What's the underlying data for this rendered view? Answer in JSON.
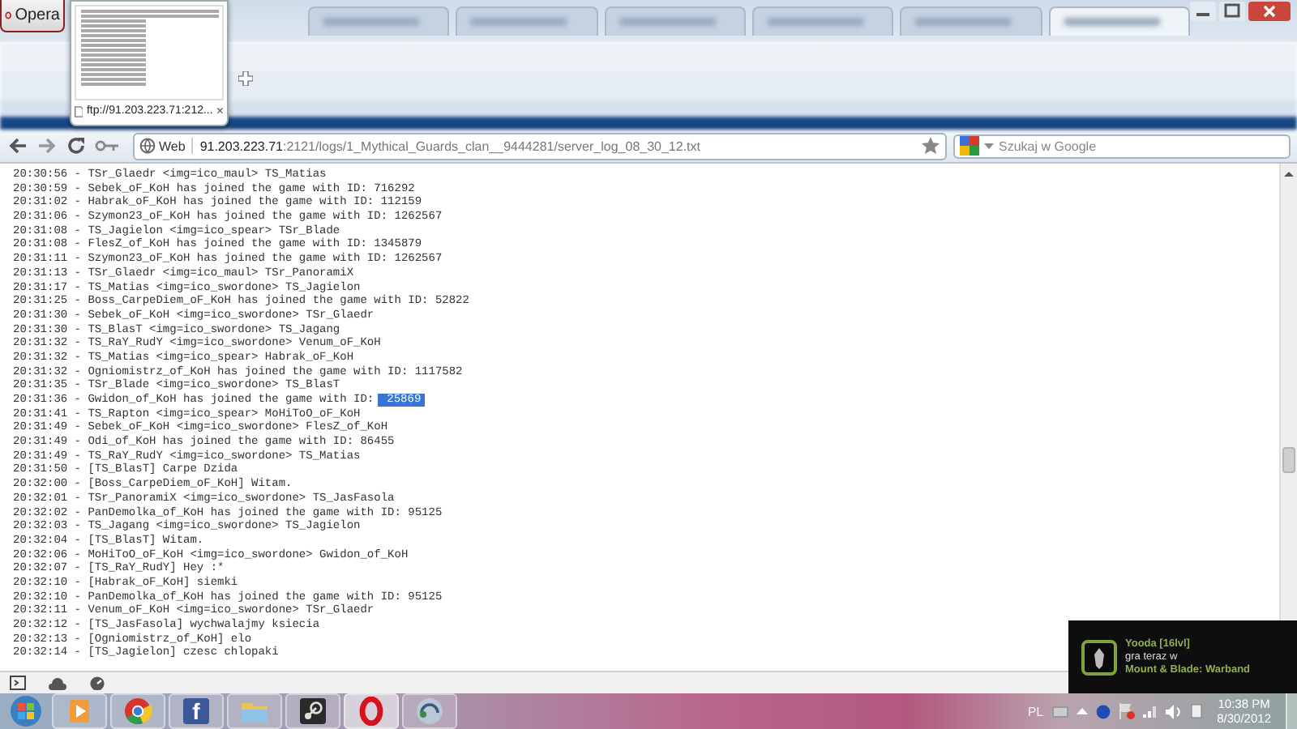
{
  "browser": {
    "menu_button": "Opera",
    "tabs": [
      {
        "selected": false
      },
      {
        "selected": false
      },
      {
        "selected": false
      },
      {
        "selected": false
      },
      {
        "selected": false
      },
      {
        "selected": true
      }
    ]
  },
  "tab_preview": {
    "caption": "ftp://91.203.223.71:212...",
    "close": "×"
  },
  "address_bar": {
    "badge": "Web",
    "url_host": "91.203.223.71",
    "url_rest": ":2121/logs/1_Mythical_Guards_clan__9444281/server_log_08_30_12.txt"
  },
  "search": {
    "placeholder": "Szukaj w Google"
  },
  "log": {
    "lines": [
      {
        "text": "20:30:56 - TSr_Glaedr <img=ico_maul> TS_Matias"
      },
      {
        "text": "20:30:59 - Sebek_oF_KoH has joined the game with ID: 716292"
      },
      {
        "text": "20:31:02 - Habrak_oF_KoH has joined the game with ID: 112159"
      },
      {
        "text": "20:31:06 - Szymon23_oF_KoH has joined the game with ID: 1262567"
      },
      {
        "text": "20:31:08 - TS_Jagielon <img=ico_spear> TSr_Blade"
      },
      {
        "text": "20:31:08 - FlesZ_of_KoH has joined the game with ID: 1345879"
      },
      {
        "text": "20:31:11 - Szymon23_oF_KoH has joined the game with ID: 1262567"
      },
      {
        "text": "20:31:13 - TSr_Glaedr <img=ico_maul> TSr_PanoramiX"
      },
      {
        "text": "20:31:17 - TS_Matias <img=ico_swordone> TS_Jagielon"
      },
      {
        "text": "20:31:25 - Boss_CarpeDiem_oF_KoH has joined the game with ID: 52822"
      },
      {
        "text": "20:31:30 - Sebek_oF_KoH <img=ico_swordone> TSr_Glaedr"
      },
      {
        "text": "20:31:30 - TS_BlasT <img=ico_swordone> TS_Jagang"
      },
      {
        "text": "20:31:32 - TS_RaY_RudY <img=ico_swordone> Venum_oF_KoH"
      },
      {
        "text": "20:31:32 - TS_Matias <img=ico_spear> Habrak_oF_KoH"
      },
      {
        "text": "20:31:32 - Ogniomistrz_of_KoH has joined the game with ID: 1117582"
      },
      {
        "text": "20:31:35 - TSr_Blade <img=ico_swordone> TS_BlasT"
      },
      {
        "text": "20:31:36 - Gwidon_of_KoH has joined the game with ID:",
        "selection": "25869"
      },
      {
        "text": "20:31:41 - TS_Rapton <img=ico_spear> MoHiToO_oF_KoH"
      },
      {
        "text": "20:31:49 - Sebek_oF_KoH <img=ico_swordone> FlesZ_of_KoH"
      },
      {
        "text": "20:31:49 - Odi_of_KoH has joined the game with ID: 86455"
      },
      {
        "text": "20:31:49 - TS_RaY_RudY <img=ico_swordone> TS_Matias"
      },
      {
        "text": "20:31:50 - [TS_BlasT] Carpe Dzida"
      },
      {
        "text": "20:32:00 - [Boss_CarpeDiem_oF_KoH] Witam."
      },
      {
        "text": "20:32:01 - TSr_PanoramiX <img=ico_swordone> TS_JasFasola"
      },
      {
        "text": "20:32:02 - PanDemolka_of_KoH has joined the game with ID: 95125"
      },
      {
        "text": "20:32:03 - TS_Jagang <img=ico_swordone> TS_Jagielon"
      },
      {
        "text": "20:32:04 - [TS_BlasT] Witam."
      },
      {
        "text": "20:32:06 - MoHiToO_oF_KoH <img=ico_swordone> Gwidon_of_KoH"
      },
      {
        "text": "20:32:07 - [TS_RaY_RudY] Hey :*"
      },
      {
        "text": "20:32:10 - [Habrak_oF_KoH] siemki"
      },
      {
        "text": "20:32:10 - PanDemolka_of_KoH has joined the game with ID: 95125"
      },
      {
        "text": "20:32:11 - Venum_oF_KoH <img=ico_swordone> TSr_Glaedr"
      },
      {
        "text": "20:32:12 - [TS_JasFasola] wychwalajmy ksiecia"
      },
      {
        "text": "20:32:13 - [Ogniomistrz_of_KoH] elo"
      },
      {
        "text": "20:32:14 - [TS_Jagielon] czesc chlopaki"
      }
    ]
  },
  "notification": {
    "title": "Yooda [16lvl]",
    "message": "gra teraz w",
    "game": "Mount & Blade: Warband"
  },
  "taskbar": {
    "apps": [
      {
        "kind": "media",
        "selected": false
      },
      {
        "kind": "chrome",
        "selected": false
      },
      {
        "kind": "facebook",
        "glyph": "f",
        "selected": false
      },
      {
        "kind": "folder",
        "selected": false
      },
      {
        "kind": "steam",
        "selected": false
      },
      {
        "kind": "opera",
        "selected": true
      },
      {
        "kind": "teamspeak",
        "selected": false
      }
    ],
    "language": "PL",
    "time": "10:38 PM",
    "date": "8/30/2012"
  }
}
